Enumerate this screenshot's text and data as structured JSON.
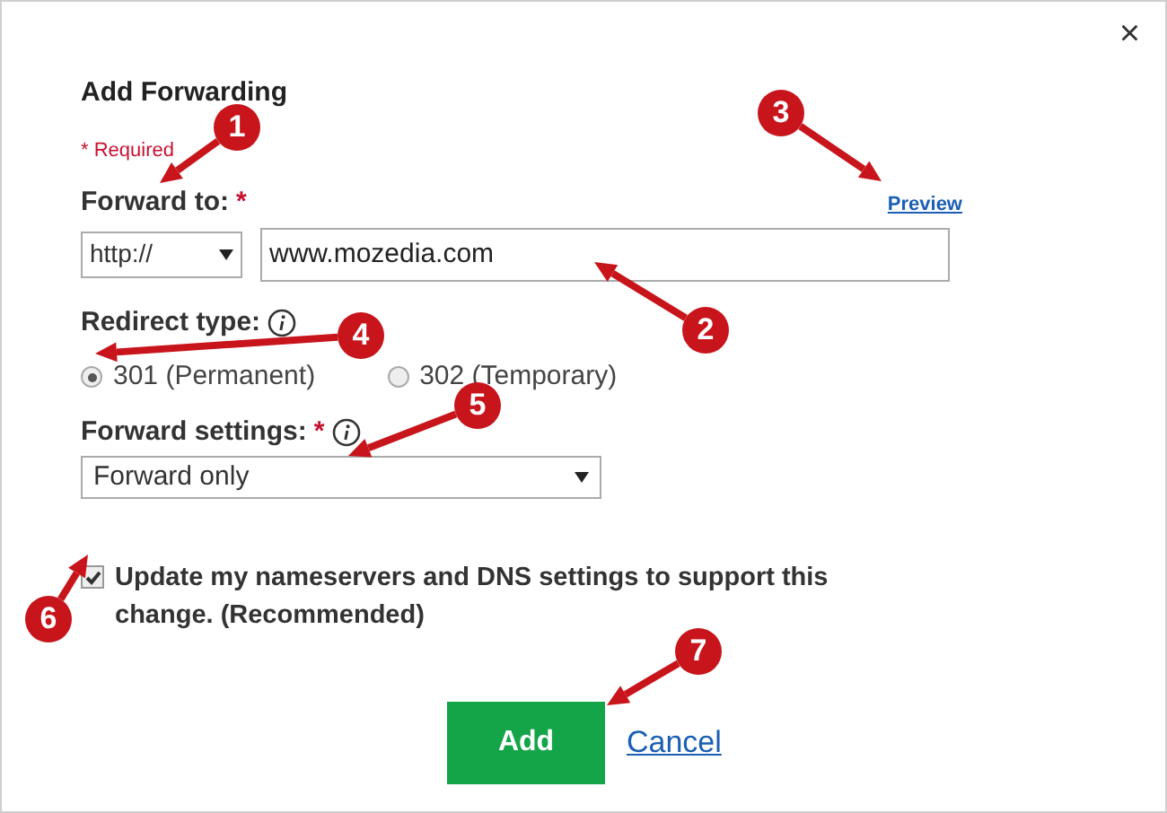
{
  "dialog": {
    "title": "Add Forwarding",
    "close": "×",
    "required_note": "* Required"
  },
  "forward_to": {
    "label": "Forward to:",
    "required_mark": "*",
    "preview_link": "Preview",
    "protocol": "http://",
    "url": "www.mozedia.com"
  },
  "redirect_type": {
    "label": "Redirect type:",
    "options": [
      {
        "label": "301 (Permanent)",
        "selected": true
      },
      {
        "label": "302 (Temporary)",
        "selected": false
      }
    ]
  },
  "forward_settings": {
    "label": "Forward settings:",
    "required_mark": "*",
    "value": "Forward only"
  },
  "update_dns": {
    "label": "Update my nameservers and DNS settings to support this change. (Recommended)",
    "checked": true
  },
  "buttons": {
    "add": "Add",
    "cancel": "Cancel"
  },
  "callouts": [
    {
      "number": "1"
    },
    {
      "number": "2"
    },
    {
      "number": "3"
    },
    {
      "number": "4"
    },
    {
      "number": "5"
    },
    {
      "number": "6"
    },
    {
      "number": "7"
    }
  ]
}
